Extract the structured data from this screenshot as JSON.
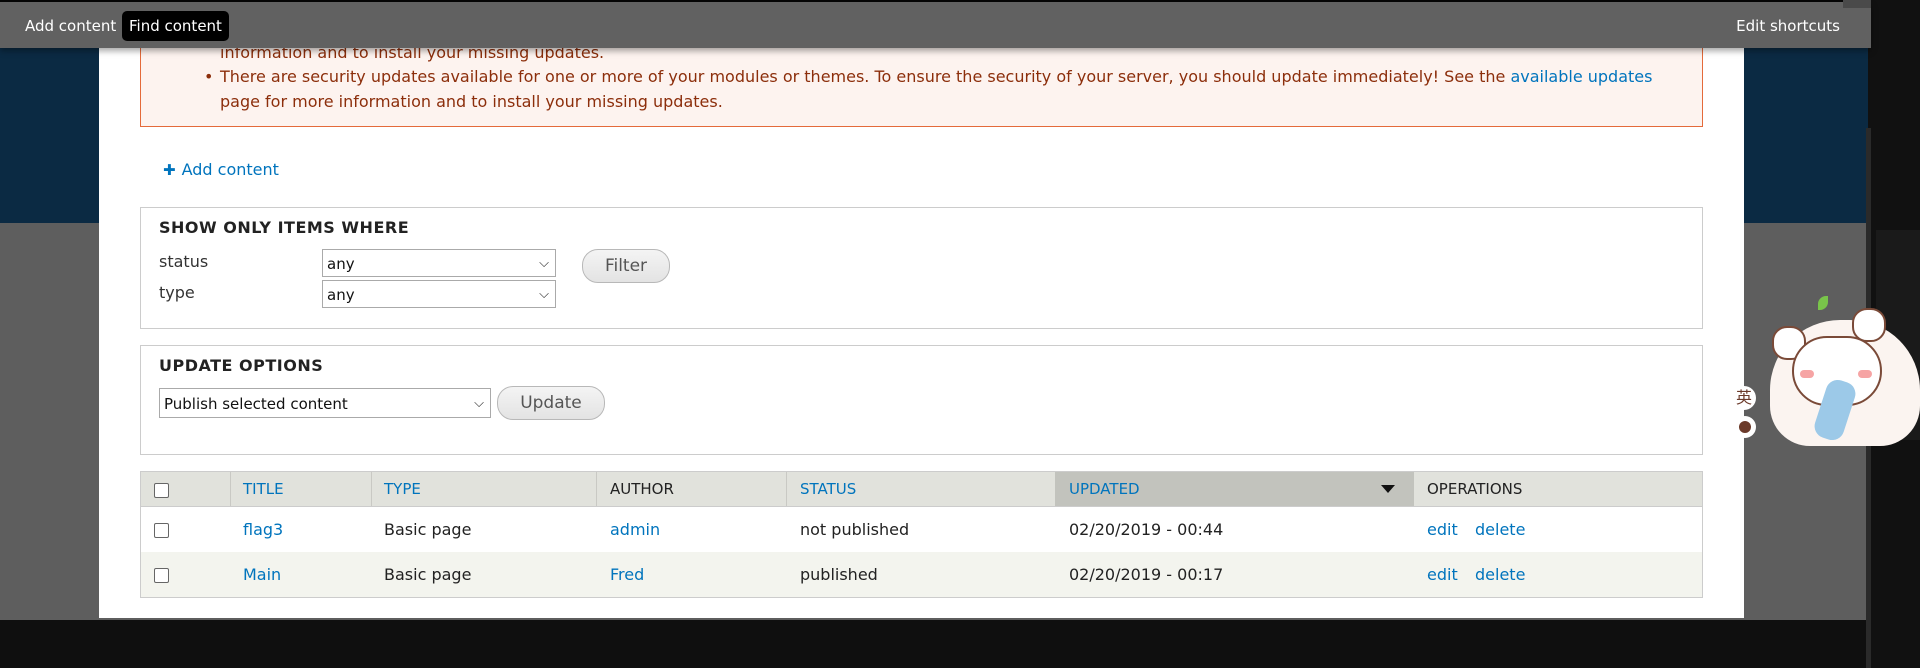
{
  "toolbar": {
    "add_content": "Add content",
    "find_content": "Find content",
    "edit_shortcuts": "Edit shortcuts"
  },
  "messages": {
    "line1": "information and to install your missing updates.",
    "line2_text": "There are security updates available for one or more of your modules or themes. To ensure the security of your server, you should update immediately! See the ",
    "line2_link": "available updates",
    "line3": "page for more information and to install your missing updates."
  },
  "actions": {
    "add_content_label": "Add content"
  },
  "filter": {
    "legend": "SHOW ONLY ITEMS WHERE",
    "status_label": "status",
    "status_value": "any",
    "type_label": "type",
    "type_value": "any",
    "button": "Filter"
  },
  "update": {
    "legend": "UPDATE OPTIONS",
    "action_value": "Publish selected content",
    "button": "Update"
  },
  "table": {
    "headers": {
      "title": "TITLE",
      "type": "TYPE",
      "author": "AUTHOR",
      "status": "STATUS",
      "updated": "UPDATED",
      "operations": "OPERATIONS"
    },
    "rows": [
      {
        "title": "flag3",
        "type": "Basic page",
        "author": "admin",
        "status": "not published",
        "updated": "02/20/2019 - 00:44",
        "edit": "edit",
        "delete": "delete"
      },
      {
        "title": "Main",
        "type": "Basic page",
        "author": "Fred",
        "status": "published",
        "updated": "02/20/2019 - 00:17",
        "edit": "edit",
        "delete": "delete"
      }
    ]
  },
  "ime": {
    "char": "英"
  },
  "colors": {
    "link": "#0074bd",
    "warning_text": "#8c2e0b",
    "warning_border": "#e46a3a",
    "toolbar": "#616161"
  }
}
